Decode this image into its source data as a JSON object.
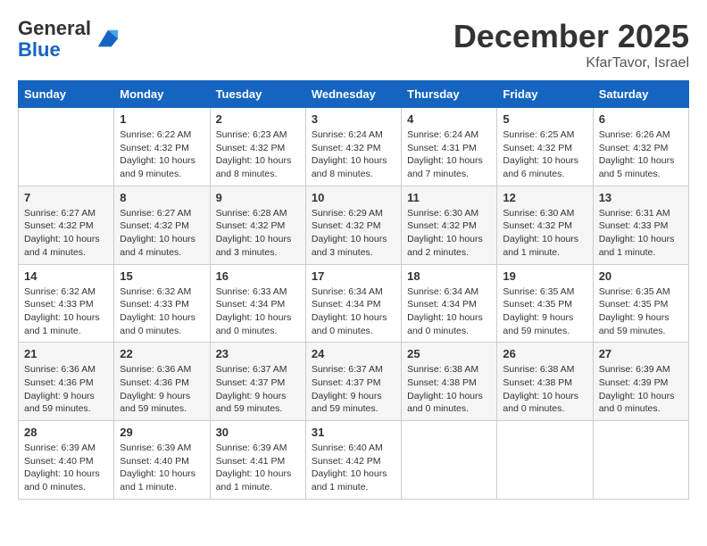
{
  "header": {
    "logo_general": "General",
    "logo_blue": "Blue",
    "month_title": "December 2025",
    "location": "KfarTavor, Israel"
  },
  "days_of_week": [
    "Sunday",
    "Monday",
    "Tuesday",
    "Wednesday",
    "Thursday",
    "Friday",
    "Saturday"
  ],
  "weeks": [
    [
      {
        "day": "",
        "info": ""
      },
      {
        "day": "1",
        "info": "Sunrise: 6:22 AM\nSunset: 4:32 PM\nDaylight: 10 hours\nand 9 minutes."
      },
      {
        "day": "2",
        "info": "Sunrise: 6:23 AM\nSunset: 4:32 PM\nDaylight: 10 hours\nand 8 minutes."
      },
      {
        "day": "3",
        "info": "Sunrise: 6:24 AM\nSunset: 4:32 PM\nDaylight: 10 hours\nand 8 minutes."
      },
      {
        "day": "4",
        "info": "Sunrise: 6:24 AM\nSunset: 4:31 PM\nDaylight: 10 hours\nand 7 minutes."
      },
      {
        "day": "5",
        "info": "Sunrise: 6:25 AM\nSunset: 4:32 PM\nDaylight: 10 hours\nand 6 minutes."
      },
      {
        "day": "6",
        "info": "Sunrise: 6:26 AM\nSunset: 4:32 PM\nDaylight: 10 hours\nand 5 minutes."
      }
    ],
    [
      {
        "day": "7",
        "info": "Sunrise: 6:27 AM\nSunset: 4:32 PM\nDaylight: 10 hours\nand 4 minutes."
      },
      {
        "day": "8",
        "info": "Sunrise: 6:27 AM\nSunset: 4:32 PM\nDaylight: 10 hours\nand 4 minutes."
      },
      {
        "day": "9",
        "info": "Sunrise: 6:28 AM\nSunset: 4:32 PM\nDaylight: 10 hours\nand 3 minutes."
      },
      {
        "day": "10",
        "info": "Sunrise: 6:29 AM\nSunset: 4:32 PM\nDaylight: 10 hours\nand 3 minutes."
      },
      {
        "day": "11",
        "info": "Sunrise: 6:30 AM\nSunset: 4:32 PM\nDaylight: 10 hours\nand 2 minutes."
      },
      {
        "day": "12",
        "info": "Sunrise: 6:30 AM\nSunset: 4:32 PM\nDaylight: 10 hours\nand 1 minute."
      },
      {
        "day": "13",
        "info": "Sunrise: 6:31 AM\nSunset: 4:33 PM\nDaylight: 10 hours\nand 1 minute."
      }
    ],
    [
      {
        "day": "14",
        "info": "Sunrise: 6:32 AM\nSunset: 4:33 PM\nDaylight: 10 hours\nand 1 minute."
      },
      {
        "day": "15",
        "info": "Sunrise: 6:32 AM\nSunset: 4:33 PM\nDaylight: 10 hours\nand 0 minutes."
      },
      {
        "day": "16",
        "info": "Sunrise: 6:33 AM\nSunset: 4:34 PM\nDaylight: 10 hours\nand 0 minutes."
      },
      {
        "day": "17",
        "info": "Sunrise: 6:34 AM\nSunset: 4:34 PM\nDaylight: 10 hours\nand 0 minutes."
      },
      {
        "day": "18",
        "info": "Sunrise: 6:34 AM\nSunset: 4:34 PM\nDaylight: 10 hours\nand 0 minutes."
      },
      {
        "day": "19",
        "info": "Sunrise: 6:35 AM\nSunset: 4:35 PM\nDaylight: 9 hours\nand 59 minutes."
      },
      {
        "day": "20",
        "info": "Sunrise: 6:35 AM\nSunset: 4:35 PM\nDaylight: 9 hours\nand 59 minutes."
      }
    ],
    [
      {
        "day": "21",
        "info": "Sunrise: 6:36 AM\nSunset: 4:36 PM\nDaylight: 9 hours\nand 59 minutes."
      },
      {
        "day": "22",
        "info": "Sunrise: 6:36 AM\nSunset: 4:36 PM\nDaylight: 9 hours\nand 59 minutes."
      },
      {
        "day": "23",
        "info": "Sunrise: 6:37 AM\nSunset: 4:37 PM\nDaylight: 9 hours\nand 59 minutes."
      },
      {
        "day": "24",
        "info": "Sunrise: 6:37 AM\nSunset: 4:37 PM\nDaylight: 9 hours\nand 59 minutes."
      },
      {
        "day": "25",
        "info": "Sunrise: 6:38 AM\nSunset: 4:38 PM\nDaylight: 10 hours\nand 0 minutes."
      },
      {
        "day": "26",
        "info": "Sunrise: 6:38 AM\nSunset: 4:38 PM\nDaylight: 10 hours\nand 0 minutes."
      },
      {
        "day": "27",
        "info": "Sunrise: 6:39 AM\nSunset: 4:39 PM\nDaylight: 10 hours\nand 0 minutes."
      }
    ],
    [
      {
        "day": "28",
        "info": "Sunrise: 6:39 AM\nSunset: 4:40 PM\nDaylight: 10 hours\nand 0 minutes."
      },
      {
        "day": "29",
        "info": "Sunrise: 6:39 AM\nSunset: 4:40 PM\nDaylight: 10 hours\nand 1 minute."
      },
      {
        "day": "30",
        "info": "Sunrise: 6:39 AM\nSunset: 4:41 PM\nDaylight: 10 hours\nand 1 minute."
      },
      {
        "day": "31",
        "info": "Sunrise: 6:40 AM\nSunset: 4:42 PM\nDaylight: 10 hours\nand 1 minute."
      },
      {
        "day": "",
        "info": ""
      },
      {
        "day": "",
        "info": ""
      },
      {
        "day": "",
        "info": ""
      }
    ]
  ]
}
